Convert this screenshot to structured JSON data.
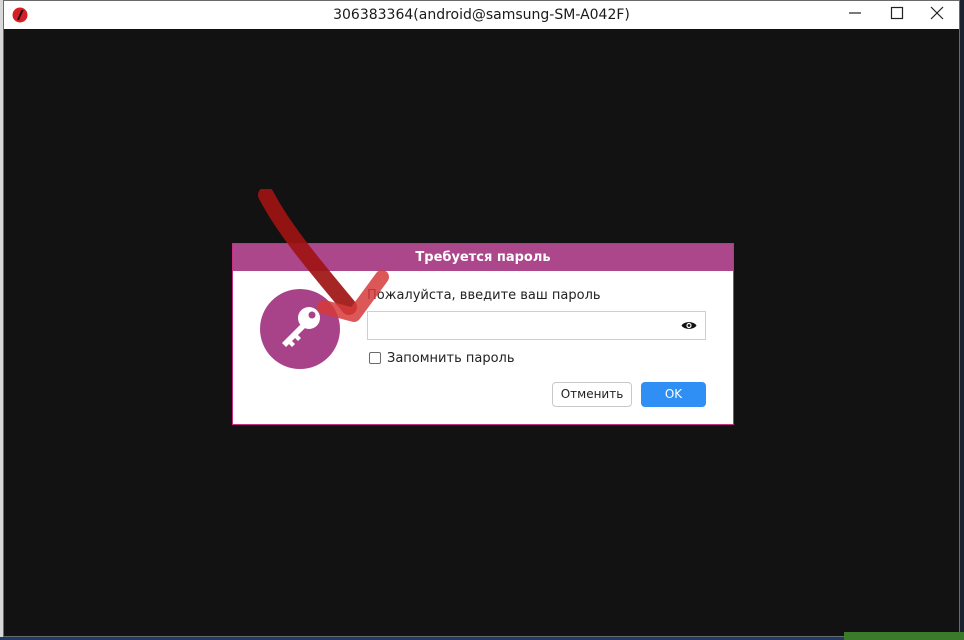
{
  "window": {
    "title": "306383364(android@samsung-SM-A042F)",
    "app_icon": "anydesk-logo-icon",
    "controls": {
      "minimize": "minimize-icon",
      "maximize": "maximize-icon",
      "close": "close-icon"
    }
  },
  "dialog": {
    "title": "Требуется пароль",
    "prompt": "Пожалуйста, введите ваш пароль",
    "password_value": "",
    "password_placeholder": "",
    "show_password_icon": "eye-icon",
    "remember_label": "Запомнить пароль",
    "remember_checked": false,
    "cancel_label": "Отменить",
    "ok_label": "OK",
    "key_icon": "key-icon"
  },
  "colors": {
    "dialog_header": "#ab478a",
    "key_circle": "#a94389",
    "ok_button": "#2f8ff5",
    "annotation_arrow": "#b01a1a"
  }
}
